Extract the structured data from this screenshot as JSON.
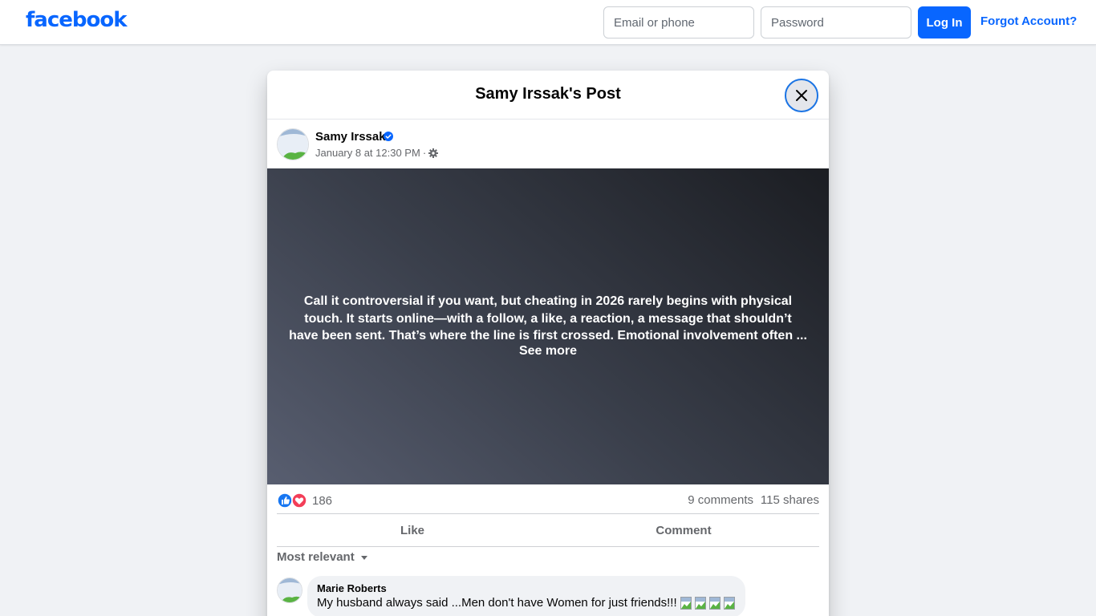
{
  "header": {
    "logo": "facebook",
    "email_placeholder": "Email or phone",
    "password_placeholder": "Password",
    "login_label": "Log In",
    "forgot_label": "Forgot Account?"
  },
  "modal": {
    "title": "Samy Irssak's Post"
  },
  "post": {
    "author": "Samy Irssak",
    "timestamp": "January 8 at 12:30 PM",
    "separator": "·",
    "text": "Call it controversial if you want, but cheating in 2026 rarely begins with physical touch. It starts online—with a follow, a like, a reaction, a message that shouldn’t have been sent. That’s where the line is first crossed. Emotional involvement often ...",
    "see_more": "See more",
    "reaction_count": "186",
    "comments_count": "9 comments",
    "shares_count": "115 shares"
  },
  "actions": {
    "like": "Like",
    "comment": "Comment"
  },
  "comments": {
    "sort_label": "Most relevant",
    "items": [
      {
        "author": "Marie Roberts",
        "text": "My husband always said ...Men don't have Women for just friends!!!"
      }
    ]
  },
  "colors": {
    "brand": "#0866ff",
    "background": "#f0f2f5",
    "secondary_text": "#65676b"
  }
}
